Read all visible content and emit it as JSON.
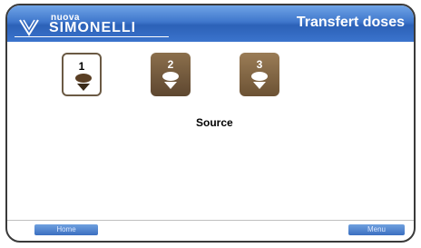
{
  "header": {
    "brand_small": "nuova",
    "brand_main": "SIMONELLI",
    "title": "Transfert doses"
  },
  "doses": [
    {
      "number": "1",
      "icon": "coffee-cup-icon",
      "state": "selected"
    },
    {
      "number": "2",
      "icon": "coffee-cup-icon",
      "state": "normal"
    },
    {
      "number": "3",
      "icon": "coffee-cup-icon",
      "state": "normal"
    }
  ],
  "source_label": "Source",
  "footer": {
    "home_label": "Home",
    "menu_label": "Menu"
  },
  "colors": {
    "header_blue": "#3f77cc",
    "dose_brown": "#6c5234",
    "selected_border": "#6b5a44"
  }
}
